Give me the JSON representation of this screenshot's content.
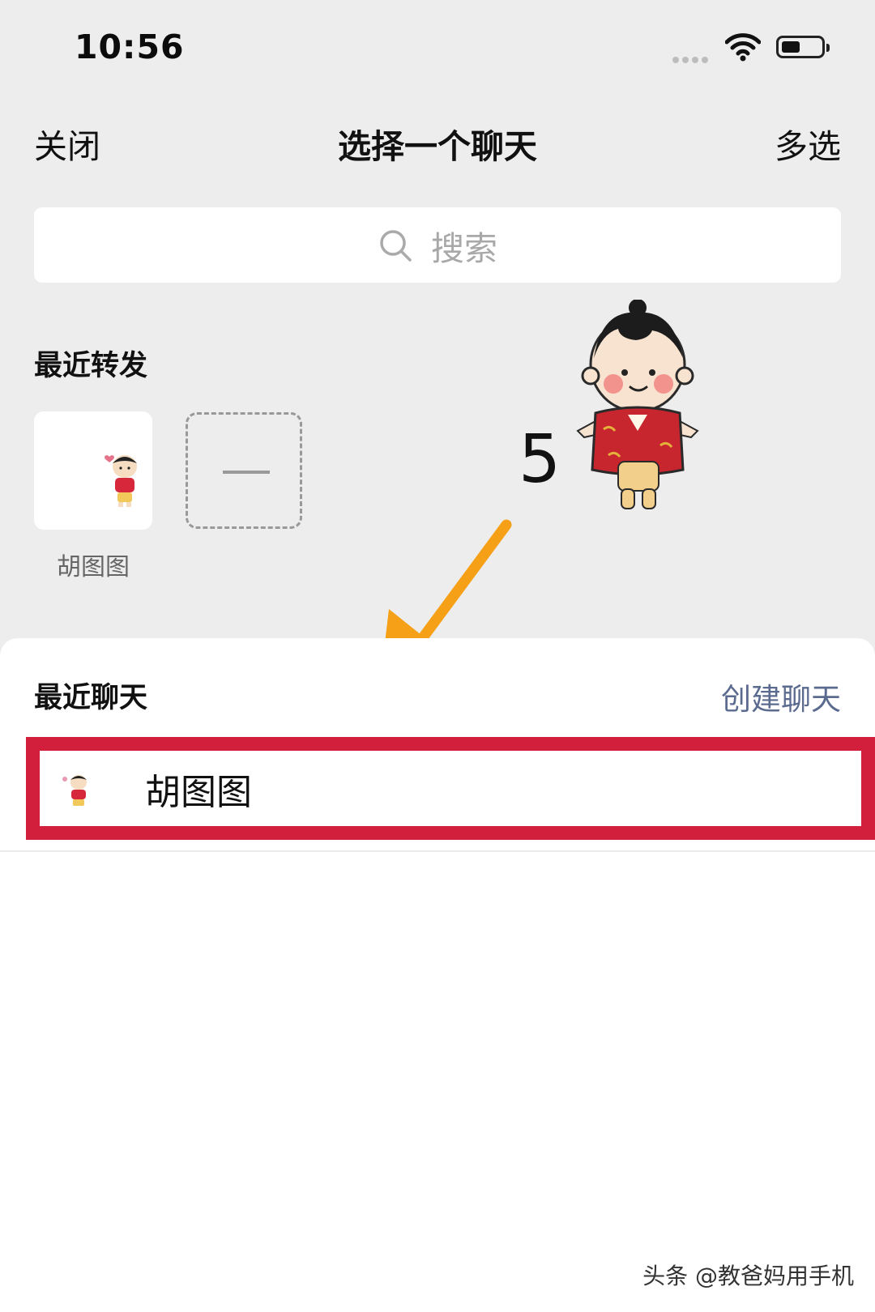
{
  "status_bar": {
    "time": "10:56"
  },
  "header": {
    "close_label": "关闭",
    "title": "选择一个聊天",
    "multi_select_label": "多选"
  },
  "search": {
    "placeholder": "搜索"
  },
  "recent_forward": {
    "section_title": "最近转发",
    "items": [
      {
        "name": "胡图图"
      }
    ]
  },
  "annotation": {
    "step_number": "5",
    "arrow_color": "#f5a017"
  },
  "recent_chats": {
    "section_title": "最近聊天",
    "create_chat_label": "创建聊天",
    "items": [
      {
        "name": "胡图图"
      }
    ],
    "highlight_color": "#d21f3c"
  },
  "watermark": {
    "text": "头条 @教爸妈用手机"
  }
}
